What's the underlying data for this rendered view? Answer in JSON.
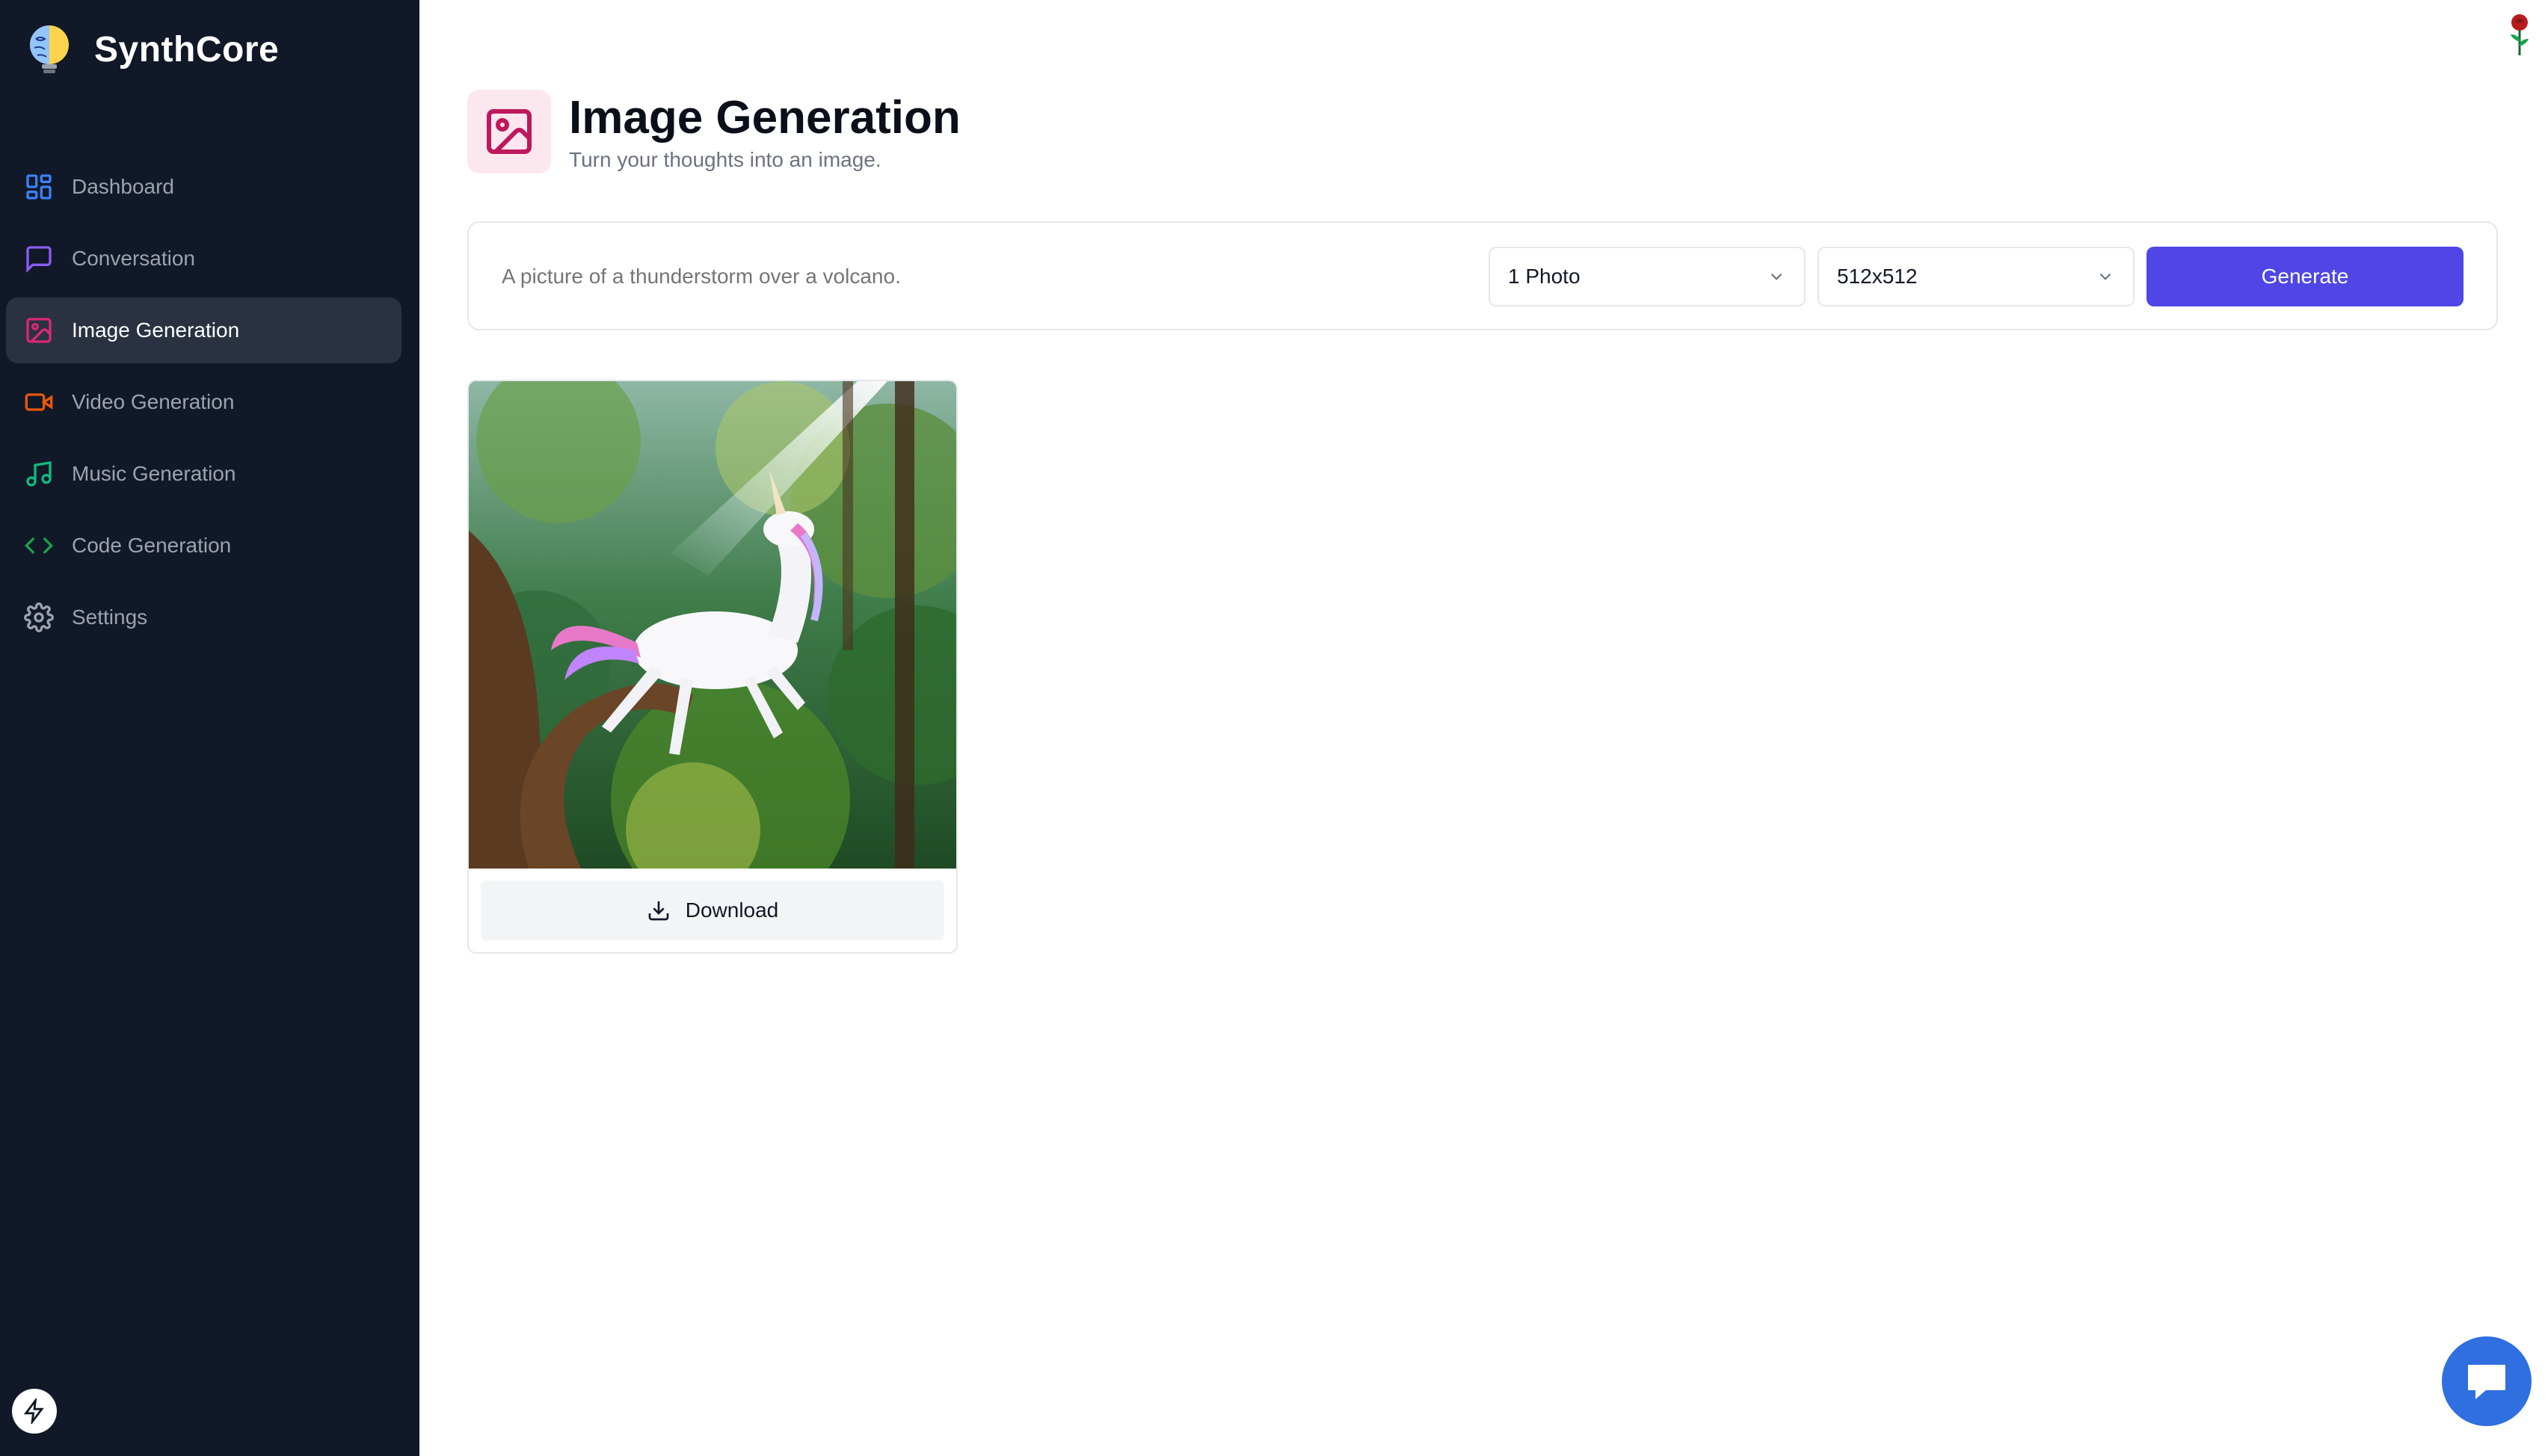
{
  "brand": {
    "name": "SynthCore"
  },
  "sidebar": {
    "items": [
      {
        "label": "Dashboard",
        "icon": "dashboard-grid-icon",
        "color": "#3b82f6",
        "active": false
      },
      {
        "label": "Conversation",
        "icon": "message-square-icon",
        "color": "#8b5cf6",
        "active": false
      },
      {
        "label": "Image Generation",
        "icon": "image-icon",
        "color": "#db2777",
        "active": true
      },
      {
        "label": "Video Generation",
        "icon": "video-camera-icon",
        "color": "#ea580c",
        "active": false
      },
      {
        "label": "Music Generation",
        "icon": "music-note-icon",
        "color": "#10b981",
        "active": false
      },
      {
        "label": "Code Generation",
        "icon": "code-brackets-icon",
        "color": "#16a34a",
        "active": false
      },
      {
        "label": "Settings",
        "icon": "gear-icon",
        "color": "#9ca3af",
        "active": false
      }
    ]
  },
  "header": {
    "title": "Image Generation",
    "subtitle": "Turn your thoughts into an image.",
    "icon": "image-icon",
    "icon_color": "#be185d",
    "icon_bg": "#fce7ef"
  },
  "form": {
    "prompt_placeholder": "A picture of a thunderstorm over a volcano.",
    "amount_value": "1 Photo",
    "resolution_value": "512x512",
    "generate_label": "Generate",
    "accent": "#4f46e5"
  },
  "results": [
    {
      "download_label": "Download"
    }
  ],
  "colors": {
    "sidebar_bg": "#111827",
    "chat_fab": "#2f6fe0"
  }
}
